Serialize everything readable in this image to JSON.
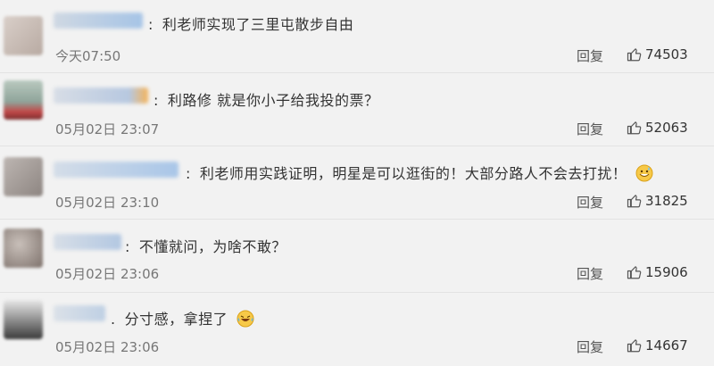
{
  "comments": [
    {
      "text": "利老师实现了三里屯散步自由",
      "time": "今天07:50",
      "reply": "回复",
      "likes": "74503"
    },
    {
      "text": "利路修 就是你小子给我投的票？",
      "time": "05月02日 23:07",
      "reply": "回复",
      "likes": "52063"
    },
    {
      "text": "利老师用实践证明，明星是可以逛街的！大部分路人不会去打扰！",
      "time": "05月02日 23:10",
      "reply": "回复",
      "likes": "31825",
      "emoji": "grin-sweat-emoji"
    },
    {
      "text": "不懂就问，为啥不敢？",
      "time": "05月02日 23:06",
      "reply": "回复",
      "likes": "15906"
    },
    {
      "text": "分寸感，拿捏了",
      "time": "05月02日 23:06",
      "reply": "回复",
      "likes": "14667",
      "emoji": "tears-of-joy-emoji"
    }
  ],
  "colors": {
    "background": "#f2f2f2",
    "timestamp": "#777777",
    "text": "#333333"
  }
}
